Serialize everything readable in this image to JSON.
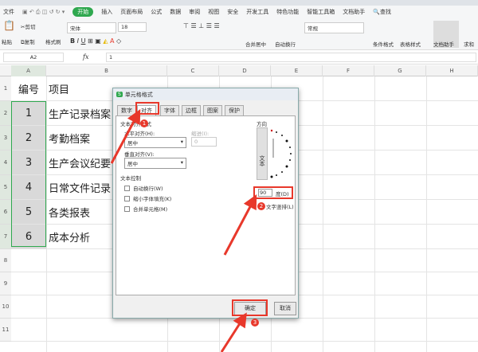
{
  "menu": {
    "file": "文件",
    "items": [
      "开始",
      "插入",
      "页面布局",
      "公式",
      "数据",
      "审阅",
      "视图",
      "安全",
      "开发工具",
      "特色功能",
      "智能工具箱",
      "文档助手"
    ],
    "search": "查找"
  },
  "ribbon": {
    "paste": "粘贴",
    "cut": "剪切",
    "copy": "复制",
    "format_painter": "格式刷",
    "font": "宋体",
    "size": "18",
    "merge": "合并居中",
    "wrap": "自动换行",
    "number_format": "常规",
    "cond_format": "条件格式",
    "table_style": "表格样式",
    "doc_helper": "文档助手",
    "sum": "求和"
  },
  "formula_bar": {
    "name_box": "A2",
    "fx": "fx",
    "value": "1"
  },
  "columns": [
    "A",
    "B",
    "C",
    "D",
    "E",
    "F",
    "G",
    "H"
  ],
  "rows": [
    "1",
    "2",
    "3",
    "4",
    "5",
    "6",
    "7",
    "8",
    "9",
    "10",
    "11"
  ],
  "cells": [
    [
      "编号",
      "项目"
    ],
    [
      "1",
      "生产记录档案"
    ],
    [
      "2",
      "考勤档案"
    ],
    [
      "3",
      "生产会议纪要"
    ],
    [
      "4",
      "日常文件记录"
    ],
    [
      "5",
      "各类报表"
    ],
    [
      "6",
      "成本分析"
    ]
  ],
  "dialog": {
    "title": "单元格格式",
    "tabs": [
      "数字",
      "对齐",
      "字体",
      "边框",
      "图案",
      "保护"
    ],
    "active_tab": "对齐",
    "text_align_section": "文本对齐方式",
    "horizontal_label": "水平对齐(H):",
    "horizontal_value": "居中",
    "indent_label": "缩进(I):",
    "indent_value": "0",
    "vertical_label": "垂直对齐(V):",
    "vertical_value": "居中",
    "text_control": "文本控制",
    "checkboxes": [
      "自动换行(W)",
      "缩小字体填充(K)",
      "合并单元格(M)"
    ],
    "orientation": "方向",
    "orient_text": "文本",
    "degrees_value": "90",
    "degrees_label": "度(D)",
    "vertical_text": "文字竖排(L)",
    "ok": "确定",
    "cancel": "取消"
  },
  "annotations": [
    "1",
    "2",
    "3"
  ],
  "colors": {
    "accent": "#2fa84f",
    "annotation": "#e8382b"
  }
}
